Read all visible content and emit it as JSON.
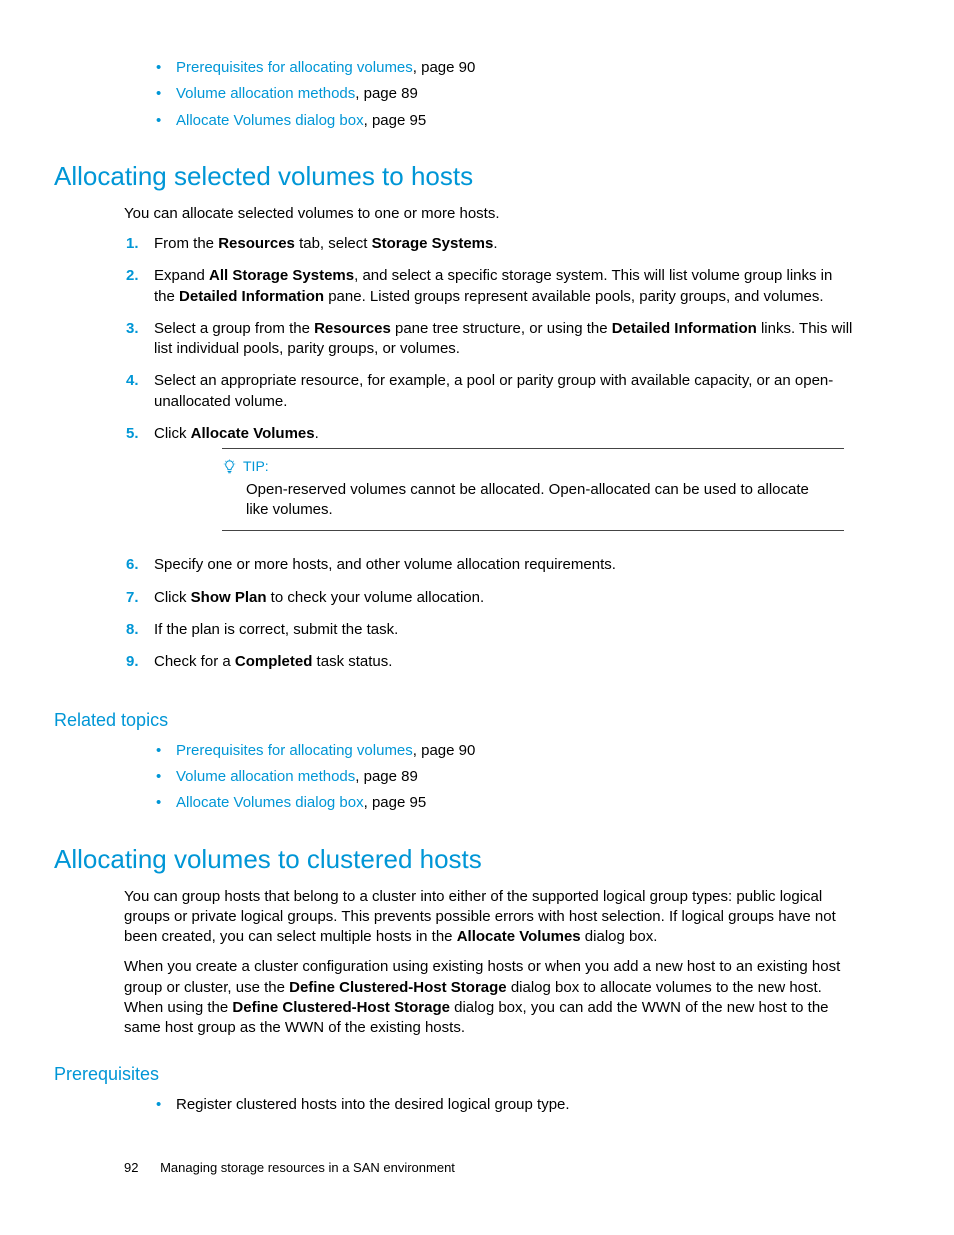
{
  "topRelatedList": [
    {
      "link": "Prerequisites for allocating volumes",
      "suffix": ", page 90"
    },
    {
      "link": "Volume allocation methods",
      "suffix": ", page 89"
    },
    {
      "link": "Allocate Volumes dialog box",
      "suffix": ", page 95"
    }
  ],
  "section1": {
    "heading": "Allocating selected volumes to hosts",
    "intro": "You can allocate selected volumes to one or more hosts."
  },
  "steps1": {
    "s1_a": "From the ",
    "s1_b": "Resources",
    "s1_c": " tab, select ",
    "s1_d": "Storage Systems",
    "s1_e": ".",
    "s2_a": "Expand ",
    "s2_b": "All Storage Systems",
    "s2_c": ", and select a specific storage system. This will list volume group links in the ",
    "s2_d": "Detailed Information",
    "s2_e": " pane. Listed groups represent available pools, parity groups, and volumes.",
    "s3_a": "Select a group from the ",
    "s3_b": "Resources",
    "s3_c": " pane tree structure, or using the ",
    "s3_d": "Detailed Information",
    "s3_e": " links. This will list individual pools, parity groups, or volumes.",
    "s4": "Select an appropriate resource, for example, a pool or parity group with available capacity, or an open-unallocated volume.",
    "s5_a": "Click ",
    "s5_b": "Allocate Volumes",
    "s5_c": ".",
    "s6": "Specify one or more hosts, and other volume allocation requirements.",
    "s7_a": "Click ",
    "s7_b": "Show Plan",
    "s7_c": " to check your volume allocation.",
    "s8": "If the plan is correct, submit the task.",
    "s9_a": "Check for a ",
    "s9_b": "Completed",
    "s9_c": " task status."
  },
  "tip": {
    "label": "TIP:",
    "body": "Open-reserved volumes cannot be allocated. Open-allocated can be used to allocate like volumes."
  },
  "related1": {
    "heading": "Related topics",
    "items": [
      {
        "link": "Prerequisites for allocating volumes",
        "suffix": ", page 90"
      },
      {
        "link": "Volume allocation methods",
        "suffix": ", page 89"
      },
      {
        "link": "Allocate Volumes dialog box",
        "suffix": ", page 95"
      }
    ]
  },
  "section2": {
    "heading": "Allocating volumes to clustered hosts",
    "p1_a": "You can group hosts that belong to a cluster into either of the supported logical group types: public logical groups or private logical groups. This prevents possible errors with host selection. If logical groups have not been created, you can select multiple hosts in the ",
    "p1_b": "Allocate Volumes",
    "p1_c": " dialog box.",
    "p2_a": "When you create a cluster configuration using existing hosts or when you add a new host to an existing host group or cluster, use the ",
    "p2_b": "Define Clustered-Host Storage",
    "p2_c": "  dialog box to allocate volumes to the new host. When using the ",
    "p2_d": "Define Clustered-Host Storage",
    "p2_e": " dialog box, you can add the WWN of the new host to the same host group as the WWN of the existing hosts."
  },
  "prereq": {
    "heading": "Prerequisites",
    "items": [
      {
        "text": "Register clustered hosts into the desired logical group type."
      }
    ]
  },
  "footer": {
    "page": "92",
    "title": "Managing storage resources in a SAN environment"
  }
}
